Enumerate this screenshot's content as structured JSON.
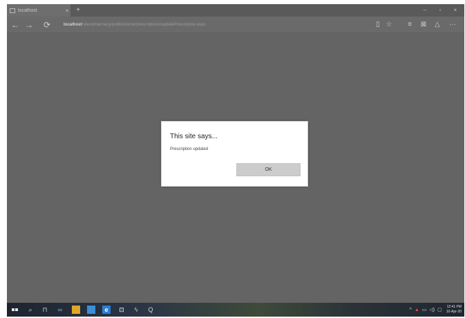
{
  "browser": {
    "tab_title": "localhost",
    "tab_close": "×",
    "new_tab": "+",
    "address_host": "localhost",
    "address_path": "/sites/pharmacy/public/doctor/prescriptions/updatePrescription.aspx",
    "window_controls": {
      "minimize": "–",
      "maximize": "▫",
      "close": "×"
    },
    "nav": {
      "back": "←",
      "forward": "→",
      "refresh": "⟳"
    },
    "tools": {
      "reading_view": "▯",
      "favorite": "☆",
      "hub": "≡",
      "notes": "⊠",
      "share": "△",
      "more": "···"
    }
  },
  "dialog": {
    "title": "This site says...",
    "message": "Prescription updated",
    "ok_label": "OK"
  },
  "taskbar": {
    "search": "⌕",
    "task_view": "⊓",
    "clock_time": "12:41 PM",
    "clock_date": "10-Apr-20",
    "tray": {
      "chevron": "^",
      "network": "▲",
      "battery": "▭",
      "volume": "◁)",
      "notifications": "▢"
    }
  },
  "colors": {
    "page_background": "#646464",
    "dialog_background": "#ffffff",
    "ok_button": "#cccccc",
    "edge_blue": "#2d7dd2"
  }
}
